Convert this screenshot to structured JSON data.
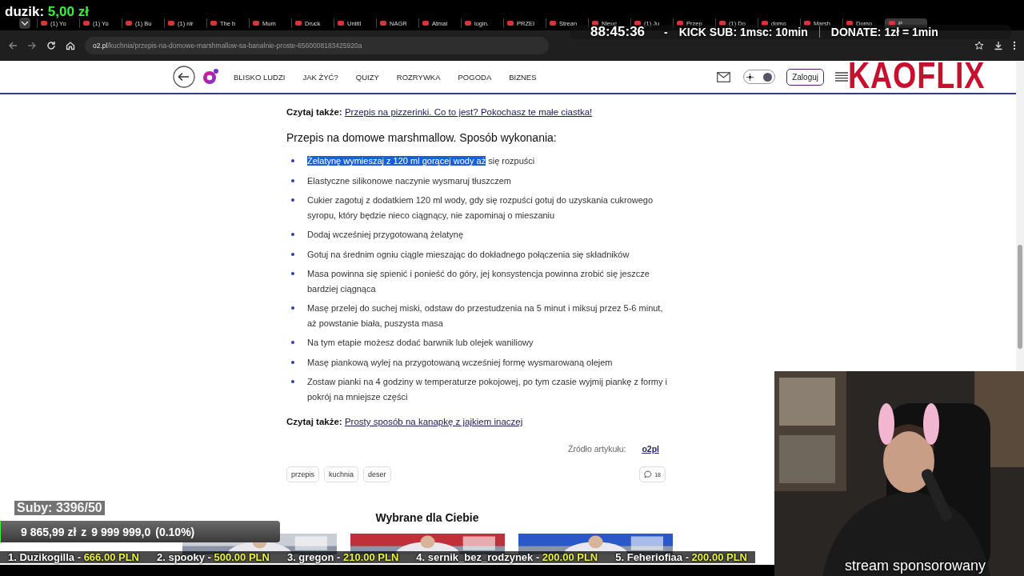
{
  "overlay": {
    "donation_alert": {
      "name": "duzik:",
      "amount": "5,00 zł"
    },
    "timer": {
      "time": "88:45:36",
      "separator": "-",
      "sub_rule": "KICK SUB: 1msc: 10min",
      "donate_rule": "DONATE: 1zł = 1min"
    },
    "logo": "KAOFLIX",
    "subs": "Suby: 3396/50",
    "goal": {
      "raised": "9 865,99 zł",
      "connector": "z",
      "target": "9 999 999,0",
      "percent": "(0.10%)",
      "level": 0.001
    },
    "top_donors": [
      {
        "name": "1. Duzikogilla -",
        "amount": "666.00 PLN"
      },
      {
        "name": "2. spooky -",
        "amount": "500.00 PLN"
      },
      {
        "name": "3. gregon -",
        "amount": "210.00 PLN"
      },
      {
        "name": "4. sernik_bez_rodzynek -",
        "amount": "200.00 PLN"
      },
      {
        "name": "5. Feheriofiaa -",
        "amount": "200.00 PLN"
      }
    ],
    "sponsor_note": "stream sponsorowany"
  },
  "browser": {
    "tabs": [
      {
        "title": "(1) Yo",
        "selected": false
      },
      {
        "title": "(1) Yo",
        "selected": false
      },
      {
        "title": "(1) Bu",
        "selected": false
      },
      {
        "title": "(1) nir",
        "selected": false
      },
      {
        "title": "The b",
        "selected": false
      },
      {
        "title": "Mum",
        "selected": false
      },
      {
        "title": "Druck",
        "selected": false
      },
      {
        "title": "Untitl",
        "selected": false
      },
      {
        "title": "NAGR",
        "selected": false
      },
      {
        "title": "Atmal",
        "selected": false
      },
      {
        "title": "login.",
        "selected": false
      },
      {
        "title": "PRZEI",
        "selected": false
      },
      {
        "title": "Strean",
        "selected": false
      },
      {
        "title": "Nieuc",
        "selected": false
      },
      {
        "title": "(1) Ju",
        "selected": false
      },
      {
        "title": "Przep",
        "selected": false
      },
      {
        "title": "(1) Do",
        "selected": false
      },
      {
        "title": "domo",
        "selected": false
      },
      {
        "title": "Marsh",
        "selected": false
      },
      {
        "title": "Domo",
        "selected": false
      },
      {
        "title": "P",
        "selected": true
      }
    ],
    "address": {
      "domain": "o2.pl",
      "path": "/kuchnia/przepis-na-domowe-marshmallow-sa-banalnie-proste-6560008183425920a"
    }
  },
  "site": {
    "nav": [
      "BLISKO LUDZI",
      "JAK ŻYĆ?",
      "QUIZY",
      "ROZRYWKA",
      "POGODA",
      "BIZNES"
    ],
    "theme_toggle": {
      "on": true
    },
    "login_button": "Zaloguj"
  },
  "article": {
    "read_also_top": {
      "label": "Czytaj także:",
      "link": "Przepis na pizzerinki. Co to jest? Pokochasz te małe ciastka!"
    },
    "heading": "Przepis na domowe marshmallow. Sposób wykonania:",
    "steps": [
      [
        {
          "text": "Żelatynę wymieszaj z 120 ml gorącej wody aż",
          "selected": true
        },
        {
          "text": " się rozpuści",
          "selected": false
        }
      ],
      [
        {
          "text": "Elastyczne silikonowe naczynie wysmaruj tłuszczem",
          "selected": false
        }
      ],
      [
        {
          "text": "Cukier zagotuj z dodatkiem 120 ml wody, gdy się rozpuści gotuj do uzyskania cukrowego syropu, który będzie nieco ciągnący, nie zapominaj o mieszaniu",
          "selected": false
        }
      ],
      [
        {
          "text": "Dodaj wcześniej przygotowaną żelatynę",
          "selected": false
        }
      ],
      [
        {
          "text": "Gotuj na średnim ogniu ciągle mieszając do dokładnego połączenia się składników",
          "selected": false
        }
      ],
      [
        {
          "text": "Masa powinna się spienić i ponieść do góry, jej konsystencja powinna zrobić się jeszcze bardziej ciągnąca",
          "selected": false
        }
      ],
      [
        {
          "text": "Masę przelej do suchej miski, odstaw do przestudzenia na 5 minut i miksuj przez 5-6 minut, aż powstanie biała, puszysta masa",
          "selected": false
        }
      ],
      [
        {
          "text": "Na tym etapie możesz dodać barwnik lub olejek waniliowy",
          "selected": false
        }
      ],
      [
        {
          "text": "Masę piankową wylej na przygotowaną wcześniej formę wysmarowaną olejem",
          "selected": false
        }
      ],
      [
        {
          "text": "Zostaw pianki na 4 godziny w temperaturze pokojowej, po tym czasie wyjmij piankę z formy i pokrój na mniejsze części",
          "selected": false
        }
      ]
    ],
    "read_also_bottom": {
      "label": "Czytaj także:",
      "link": "Prosty sposób na kanapkę z jajkiem inaczej"
    },
    "source": {
      "label": "Źródło artykułu:",
      "link": "o2pl"
    },
    "tags": [
      "przepis",
      "kuchnia",
      "deser"
    ],
    "comments": "18",
    "recommended": {
      "title": "Wybrane dla Ciebie"
    }
  }
}
